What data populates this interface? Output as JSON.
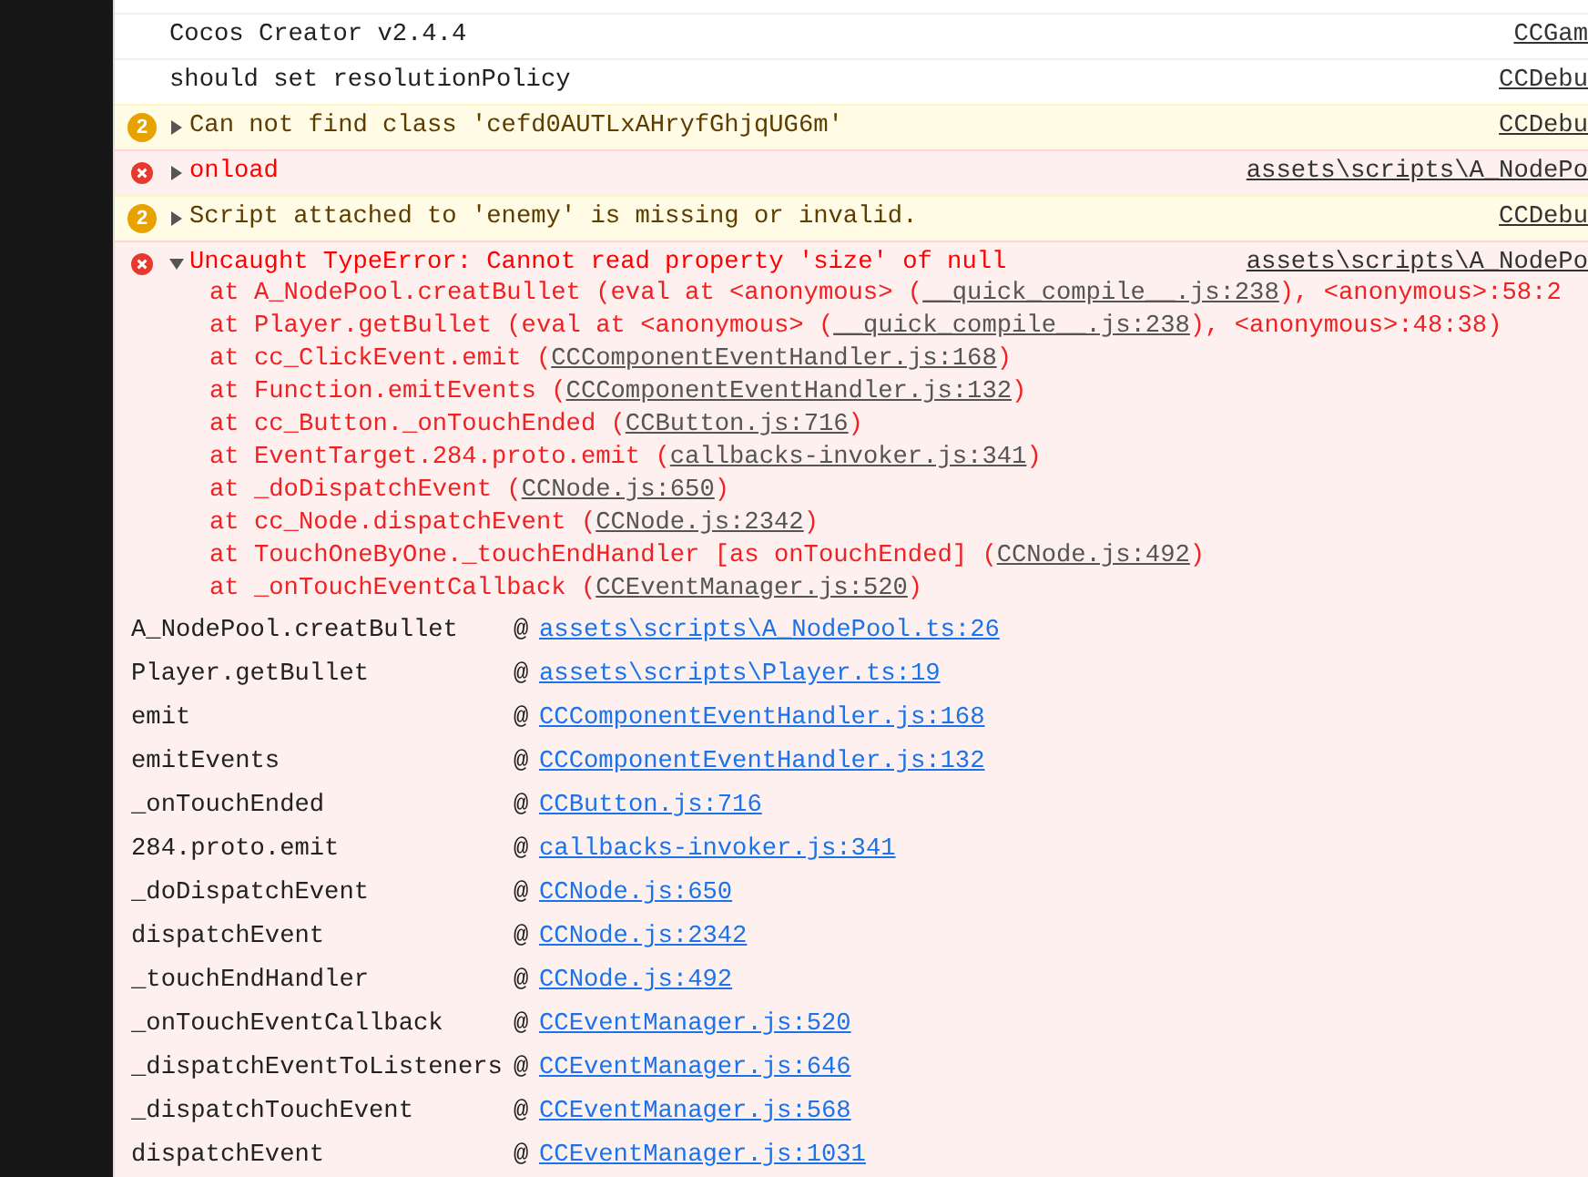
{
  "console": {
    "messages": [
      {
        "kind": "log",
        "text": "Cocos Creator v2.4.4",
        "source": "CCGam"
      },
      {
        "kind": "log",
        "text": "should set resolutionPolicy",
        "source": "CCDebu"
      },
      {
        "kind": "warning",
        "count": "2",
        "expanded": false,
        "text": "Can not find class 'cefd0AUTLxAHryfGhjqUG6m'",
        "source": "CCDebu"
      },
      {
        "kind": "error",
        "expanded": false,
        "text": "onload",
        "source": "assets\\scripts\\A_NodePo"
      },
      {
        "kind": "warning",
        "count": "2",
        "expanded": false,
        "text": "Script attached to 'enemy' is missing or invalid.",
        "source": "CCDebu"
      },
      {
        "kind": "error",
        "expanded": true,
        "text": "Uncaught TypeError: Cannot read property 'size' of null",
        "source": "assets\\scripts\\A_NodePo",
        "stack": [
          {
            "prefix": "at A_NodePool.creatBullet (eval at <anonymous> (",
            "link": "__quick_compile__.js:238",
            "suffix": "), <anonymous>:58:2"
          },
          {
            "prefix": "at Player.getBullet (eval at <anonymous> (",
            "link": "__quick_compile__.js:238",
            "suffix": "), <anonymous>:48:38)"
          },
          {
            "prefix": "at cc_ClickEvent.emit (",
            "link": "CCComponentEventHandler.js:168",
            "suffix": ")"
          },
          {
            "prefix": "at Function.emitEvents (",
            "link": "CCComponentEventHandler.js:132",
            "suffix": ")"
          },
          {
            "prefix": "at cc_Button._onTouchEnded (",
            "link": "CCButton.js:716",
            "suffix": ")"
          },
          {
            "prefix": "at EventTarget.284.proto.emit (",
            "link": "callbacks-invoker.js:341",
            "suffix": ")"
          },
          {
            "prefix": "at _doDispatchEvent (",
            "link": "CCNode.js:650",
            "suffix": ")"
          },
          {
            "prefix": "at cc_Node.dispatchEvent (",
            "link": "CCNode.js:2342",
            "suffix": ")"
          },
          {
            "prefix": "at TouchOneByOne._touchEndHandler [as onTouchEnded] (",
            "link": "CCNode.js:492",
            "suffix": ")"
          },
          {
            "prefix": "at _onTouchEventCallback (",
            "link": "CCEventManager.js:520",
            "suffix": ")"
          }
        ],
        "frames": [
          {
            "function": "A_NodePool.creatBullet",
            "separator": "@",
            "link": "assets\\scripts\\A_NodePool.ts:26"
          },
          {
            "function": "Player.getBullet",
            "separator": "@",
            "link": "assets\\scripts\\Player.ts:19"
          },
          {
            "function": "emit",
            "separator": "@",
            "link": "CCComponentEventHandler.js:168"
          },
          {
            "function": "emitEvents",
            "separator": "@",
            "link": "CCComponentEventHandler.js:132"
          },
          {
            "function": "_onTouchEnded",
            "separator": "@",
            "link": "CCButton.js:716"
          },
          {
            "function": "284.proto.emit",
            "separator": "@",
            "link": "callbacks-invoker.js:341"
          },
          {
            "function": "_doDispatchEvent",
            "separator": "@",
            "link": "CCNode.js:650"
          },
          {
            "function": "dispatchEvent",
            "separator": "@",
            "link": "CCNode.js:2342"
          },
          {
            "function": "_touchEndHandler",
            "separator": "@",
            "link": "CCNode.js:492"
          },
          {
            "function": "_onTouchEventCallback",
            "separator": "@",
            "link": "CCEventManager.js:520"
          },
          {
            "function": "_dispatchEventToListeners",
            "separator": "@",
            "link": "CCEventManager.js:646"
          },
          {
            "function": "_dispatchTouchEvent",
            "separator": "@",
            "link": "CCEventManager.js:568"
          },
          {
            "function": "dispatchEvent",
            "separator": "@",
            "link": "CCEventManager.js:1031"
          }
        ]
      }
    ]
  }
}
